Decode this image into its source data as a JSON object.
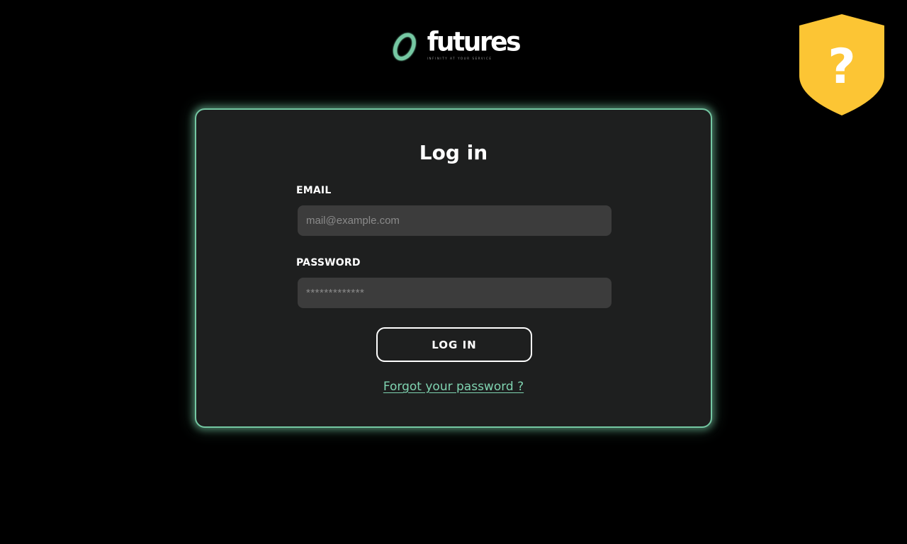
{
  "brand": {
    "name": "futures",
    "tagline": "INFINITY AT YOUR SERVICE",
    "accent_color": "#74c7a2"
  },
  "help_badge": {
    "icon": "shield-question-icon",
    "symbol": "?",
    "color": "#fcc534"
  },
  "login_form": {
    "title": "Log in",
    "email_label": "EMAIL",
    "email_placeholder": "mail@example.com",
    "password_label": "PASSWORD",
    "password_placeholder": "*************",
    "submit_label": "LOG IN",
    "forgot_password_label": "Forgot your password ?"
  }
}
